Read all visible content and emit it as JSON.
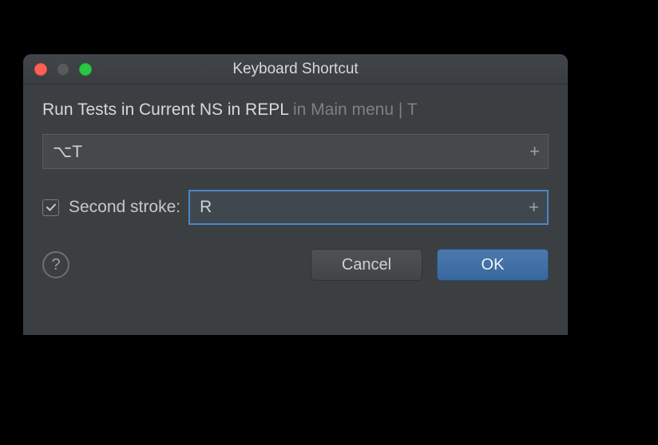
{
  "window": {
    "title": "Keyboard Shortcut"
  },
  "description": {
    "action": "Run Tests in Current NS in REPL",
    "context": " in Main menu | T"
  },
  "first_stroke": {
    "value": "⌥T",
    "plus": "+"
  },
  "second_stroke": {
    "enabled": true,
    "label": "Second stroke:",
    "value": "R",
    "plus": "+"
  },
  "help": "?",
  "buttons": {
    "cancel": "Cancel",
    "ok": "OK"
  }
}
